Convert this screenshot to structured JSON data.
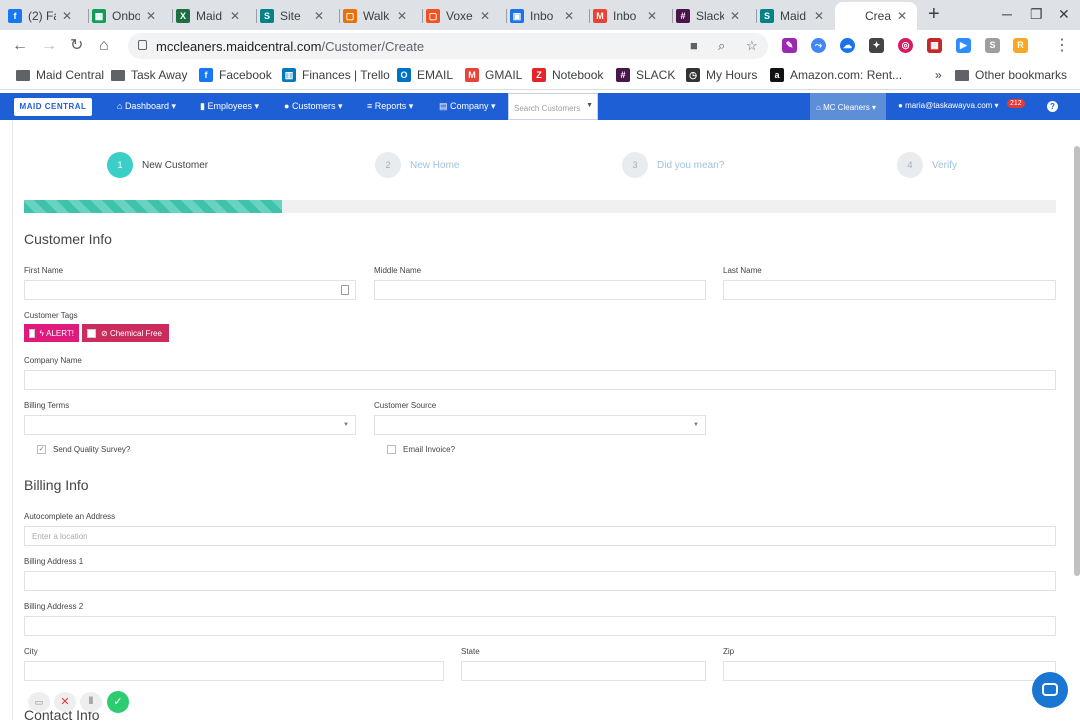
{
  "browser": {
    "tabs": [
      {
        "title": "(2) Fa",
        "icon": "facebook-icon",
        "color": "#1877f2",
        "glyph": "f"
      },
      {
        "title": "Onbo",
        "icon": "sheets-icon",
        "color": "#0f9d58",
        "glyph": "▦"
      },
      {
        "title": "Maid",
        "icon": "excel-icon",
        "color": "#1d6f42",
        "glyph": "X"
      },
      {
        "title": "Site",
        "icon": "sharepoint-icon",
        "color": "#038387",
        "glyph": "S"
      },
      {
        "title": "Walk",
        "icon": "form-icon",
        "color": "#e8710a",
        "glyph": "▢"
      },
      {
        "title": "Voxe",
        "icon": "voxer-icon",
        "color": "#f4511e",
        "glyph": "▢"
      },
      {
        "title": "Inbo",
        "icon": "inbox-icon",
        "color": "#1a73e8",
        "glyph": "▣"
      },
      {
        "title": "Inbo",
        "icon": "gmail-icon",
        "color": "#ea4335",
        "glyph": "M"
      },
      {
        "title": "Slack",
        "icon": "slack-icon",
        "color": "#4a154b",
        "glyph": "#"
      },
      {
        "title": "Maid",
        "icon": "sharepoint-icon",
        "color": "#038387",
        "glyph": "S"
      },
      {
        "title": "Creat",
        "icon": "page-icon",
        "color": "#ffffff",
        "glyph": ""
      }
    ],
    "url_host": "mccleaners.maidcentral.com",
    "url_path": "/Customer/Create",
    "bookmarks": [
      {
        "label": "Maid Central",
        "icon": "folder-icon"
      },
      {
        "label": "Task Away",
        "icon": "folder-icon"
      },
      {
        "label": "Facebook",
        "icon": "facebook-icon",
        "color": "#1877f2",
        "glyph": "f"
      },
      {
        "label": "Finances | Trello",
        "icon": "trello-icon",
        "color": "#0079bf",
        "glyph": "▥"
      },
      {
        "label": "EMAIL",
        "icon": "outlook-icon",
        "color": "#0072c6",
        "glyph": "O"
      },
      {
        "label": "GMAIL",
        "icon": "gmail-icon",
        "color": "#ea4335",
        "glyph": "M"
      },
      {
        "label": "Notebook",
        "icon": "zoho-icon",
        "color": "#e42527",
        "glyph": "Z"
      },
      {
        "label": "SLACK",
        "icon": "slack-icon",
        "color": "#4a154b",
        "glyph": "#"
      },
      {
        "label": "My Hours",
        "icon": "stopwatch-icon",
        "color": "#333333",
        "glyph": "◷"
      },
      {
        "label": "Amazon.com: Rent...",
        "icon": "amazon-icon",
        "color": "#111111",
        "glyph": "a"
      }
    ],
    "bookmarks_more": "»",
    "other_bookmarks": "Other bookmarks",
    "extension_badge": "6",
    "extension_badge2": "US"
  },
  "app": {
    "logo": "MAID CENTRAL",
    "nav": [
      "Dashboard",
      "Employees",
      "Customers",
      "Reports",
      "Company"
    ],
    "search_placeholder": "Search Customers",
    "company": "MC Cleaners",
    "account": "maria@taskawayva.com",
    "notif_count": "212"
  },
  "steps": [
    {
      "num": "1",
      "label": "New Customer"
    },
    {
      "num": "2",
      "label": "New Home"
    },
    {
      "num": "3",
      "label": "Did you mean?"
    },
    {
      "num": "4",
      "label": "Verify"
    }
  ],
  "progress_fraction": 0.25,
  "customer_info": {
    "title": "Customer Info",
    "first_name": "First Name",
    "middle_name": "Middle Name",
    "last_name": "Last Name",
    "customer_tags": "Customer Tags",
    "tag_alert": "ALERT!",
    "tag_chemical": "Chemical Free",
    "alert_color": "#e0197d",
    "chemical_color": "#cc2b5e",
    "company_name": "Company Name",
    "billing_terms": "Billing Terms",
    "customer_source": "Customer Source",
    "send_survey": "Send Quality Survey?",
    "send_survey_checked": true,
    "email_invoice": "Email Invoice?"
  },
  "billing_info": {
    "title": "Billing Info",
    "autocomplete": "Autocomplete an Address",
    "autocomplete_placeholder": "Enter a location",
    "address1": "Billing Address 1",
    "address2": "Billing Address 2",
    "city": "City",
    "state": "State",
    "zip": "Zip"
  },
  "contact_info": {
    "title": "Contact Info"
  }
}
